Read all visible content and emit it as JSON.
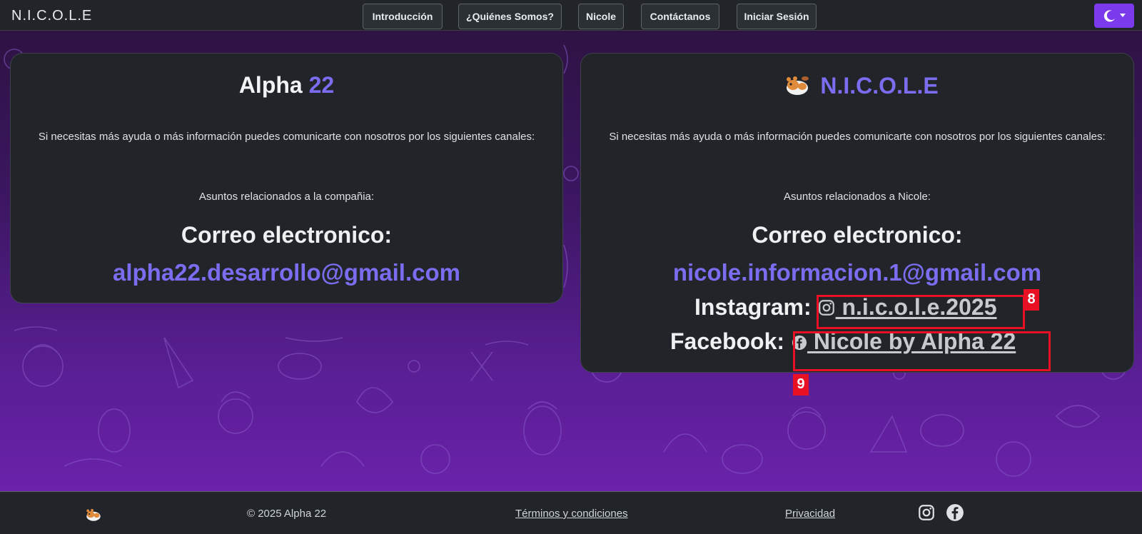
{
  "navbar": {
    "brand": "N.I.C.O.L.E",
    "items": [
      {
        "label": "Introducción"
      },
      {
        "label": "¿Quiénes Somos?"
      },
      {
        "label": "Nicole"
      },
      {
        "label": "Contáctanos"
      },
      {
        "label": "Iniciar Sesión"
      }
    ],
    "theme_icon": "moon-icon",
    "theme_color": "#7c3aed"
  },
  "company_card": {
    "title_main": "Alpha",
    "title_accent": "22",
    "paragraph": "Si necesitas más ayuda o más información puedes comunicarte con nosotros por los siguientes canales:",
    "subject": "Asuntos relacionados a la compañia:",
    "email_label": "Correo electronico:",
    "email": "alpha22.desarrollo@gmail.com"
  },
  "nicole_card": {
    "logo_icon": "hamster-logo-icon",
    "title": "N.I.C.O.L.E",
    "paragraph": "Si necesitas más ayuda o más información puedes comunicarte con nosotros por los siguientes canales:",
    "subject": "Asuntos relacionados a Nicole:",
    "email_label": "Correo electronico:",
    "email": "nicole.informacion.1@gmail.com",
    "instagram_label": "Instagram:",
    "instagram_handle": " n.i.c.o.l.e.2025",
    "facebook_label": "Facebook:",
    "facebook_handle": " Nicole by Alpha 22"
  },
  "highlights": {
    "instagram_tag": "8",
    "facebook_tag": "9",
    "color": "#e81123"
  },
  "footer": {
    "logo_icon": "hamster-logo-icon",
    "copyright": "© 2025 Alpha 22",
    "terms": "Términos y condiciones",
    "privacy": "Privacidad",
    "icons": [
      "instagram-icon",
      "facebook-icon"
    ]
  },
  "colors": {
    "accent": "#7b6cf0",
    "card_bg": "#212529",
    "page_bg": "#4a1a7a"
  }
}
